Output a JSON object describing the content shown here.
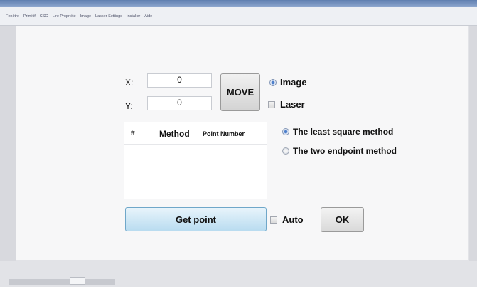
{
  "menu": {
    "items": [
      "Fenêtre",
      "Primitif",
      "CSG",
      "Lire Propriété",
      "Image",
      "Lasser Settings",
      "Installer",
      "Aide"
    ]
  },
  "coords": {
    "x_label": "X:",
    "y_label": "Y:",
    "x_value": "0",
    "y_value": "0"
  },
  "move_button": "MOVE",
  "source": {
    "image_label": "Image",
    "image_selected": true,
    "laser_label": "Laser",
    "laser_checked": false
  },
  "table": {
    "columns": [
      "#",
      "Method",
      "Point Number"
    ],
    "rows": []
  },
  "methods": {
    "least_square_label": "The least square method",
    "two_endpoint_label": "The two endpoint method",
    "selected": "least_square"
  },
  "get_point_button": "Get point",
  "auto": {
    "label": "Auto",
    "checked": false
  },
  "ok_button": "OK",
  "colors": {
    "accent": "#4d7fcb",
    "get_point_fill": "#c9e4f5"
  }
}
